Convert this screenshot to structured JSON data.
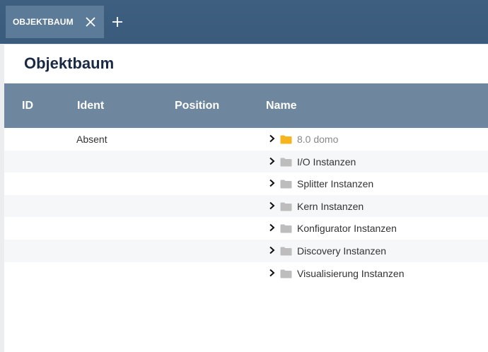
{
  "tabbar": {
    "active_tab_label": "OBJEKTBAUM",
    "close_icon": "close-icon",
    "add_icon": "plus-icon"
  },
  "page": {
    "title": "Objektbaum"
  },
  "table": {
    "columns": [
      "ID",
      "Ident",
      "Position",
      "Name"
    ],
    "rows": [
      {
        "id": "",
        "ident": "Absent",
        "position": "",
        "name": "8.0 domo",
        "folder_color": "#f6b51e",
        "muted": true
      },
      {
        "id": "",
        "ident": "",
        "position": "",
        "name": "I/O Instanzen",
        "folder_color": "#bdbdbd",
        "muted": false
      },
      {
        "id": "",
        "ident": "",
        "position": "",
        "name": "Splitter Instanzen",
        "folder_color": "#bdbdbd",
        "muted": false
      },
      {
        "id": "",
        "ident": "",
        "position": "",
        "name": "Kern Instanzen",
        "folder_color": "#bdbdbd",
        "muted": false
      },
      {
        "id": "",
        "ident": "",
        "position": "",
        "name": "Konfigurator Instanzen",
        "folder_color": "#bdbdbd",
        "muted": false
      },
      {
        "id": "",
        "ident": "",
        "position": "",
        "name": "Discovery Instanzen",
        "folder_color": "#bdbdbd",
        "muted": false
      },
      {
        "id": "",
        "ident": "",
        "position": "",
        "name": "Visualisierung Instanzen",
        "folder_color": "#bdbdbd",
        "muted": false
      }
    ]
  },
  "colors": {
    "tabbar_bg": "#3d5e7f",
    "active_tab_bg": "#5c7b98",
    "header_bg": "#6e879e",
    "title_color": "#1b2a44"
  }
}
